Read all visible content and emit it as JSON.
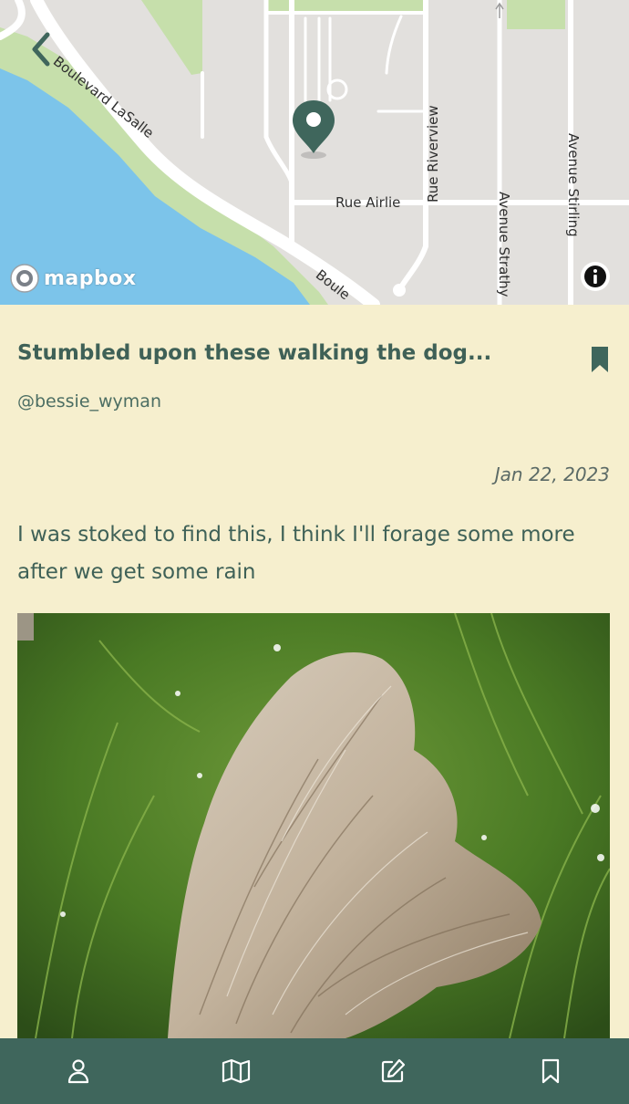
{
  "map": {
    "streets": {
      "boulevard_lasalle": "Boulevard LaSalle",
      "boulevard_lasalle_cut": "Boule",
      "rue_airlie": "Rue Airlie",
      "rue_riverview": "Rue Riverview",
      "avenue_strathy": "Avenue Strathy",
      "avenue_stirling": "Avenue Stirling"
    },
    "attribution": "mapbox",
    "back_icon": "chevron-left-icon",
    "info_icon": "info-icon",
    "pin_icon": "map-pin-icon"
  },
  "post": {
    "title": "Stumbled upon these walking the dog...",
    "author": "@bessie_wyman",
    "date": "Jan 22, 2023",
    "body": "I was stoked to find this, I think I'll forage some more after we get some rain",
    "bookmark_icon": "bookmark-filled-icon"
  },
  "nav": {
    "items": [
      {
        "icon": "user-icon"
      },
      {
        "icon": "map-icon"
      },
      {
        "icon": "edit-icon"
      },
      {
        "icon": "bookmark-icon"
      }
    ]
  },
  "colors": {
    "accent": "#3f665c",
    "background": "#f6efce",
    "water": "#7cc4ea",
    "park": "#c6dfab"
  }
}
